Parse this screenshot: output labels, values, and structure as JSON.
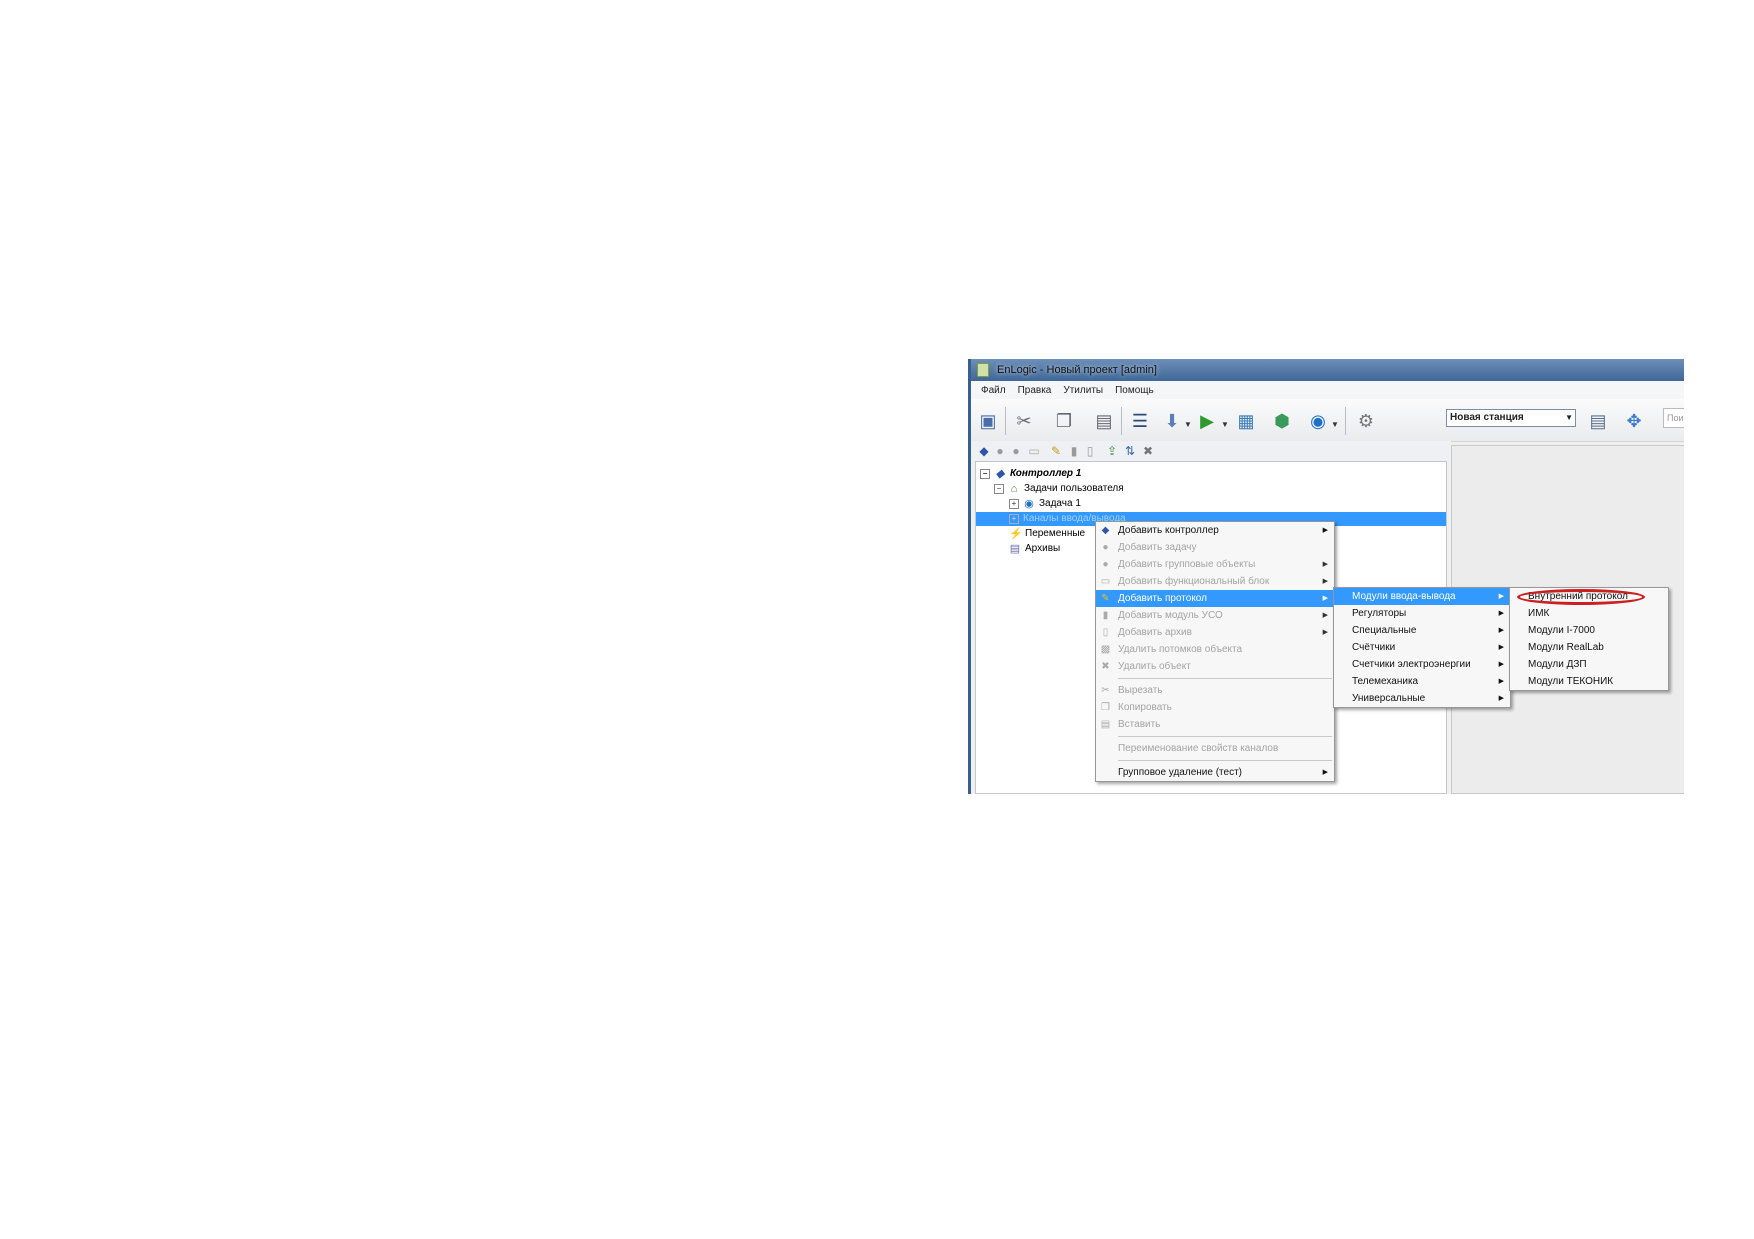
{
  "window": {
    "title": "EnLogic - Новый проект [admin]"
  },
  "menubar": {
    "items": [
      "Файл",
      "Правка",
      "Утилиты",
      "Помощь"
    ]
  },
  "toolbar": {
    "station_select": "Новая станция",
    "search_placeholder": "Пои"
  },
  "tree": {
    "controller": "Контроллер 1",
    "user_tasks": "Задачи пользователя",
    "task1": "Задача 1",
    "io_channels": "Каналы ввода/вывода",
    "variables": "Переменные",
    "archives": "Архивы"
  },
  "context_menu": {
    "items": [
      "Добавить контроллер",
      "Добавить задачу",
      "Добавить групповые объекты",
      "Добавить функциональный блок",
      "Добавить протокол",
      "Добавить модуль УСО",
      "Добавить архив",
      "Удалить потомков объекта",
      "Удалить объект",
      "Вырезать",
      "Копировать",
      "Вставить",
      "Переименование свойств каналов",
      "Групповое удаление (тест)"
    ]
  },
  "submenu_protocol": {
    "items": [
      "Модули ввода-вывода",
      "Регуляторы",
      "Специальные",
      "Счётчики",
      "Счетчики электроэнергии",
      "Телемеханика",
      "Универсальные"
    ]
  },
  "submenu_io_modules": {
    "items": [
      "Внутренний протокол",
      "ИМК",
      "Модули I-7000",
      "Модули RealLab",
      "Модули ДЗП",
      "Модули ТЕКОНИК"
    ]
  },
  "colors": {
    "highlight": "#3399ff",
    "annotation_ring": "#cc1f1f",
    "titlebar": "#3f6797"
  }
}
